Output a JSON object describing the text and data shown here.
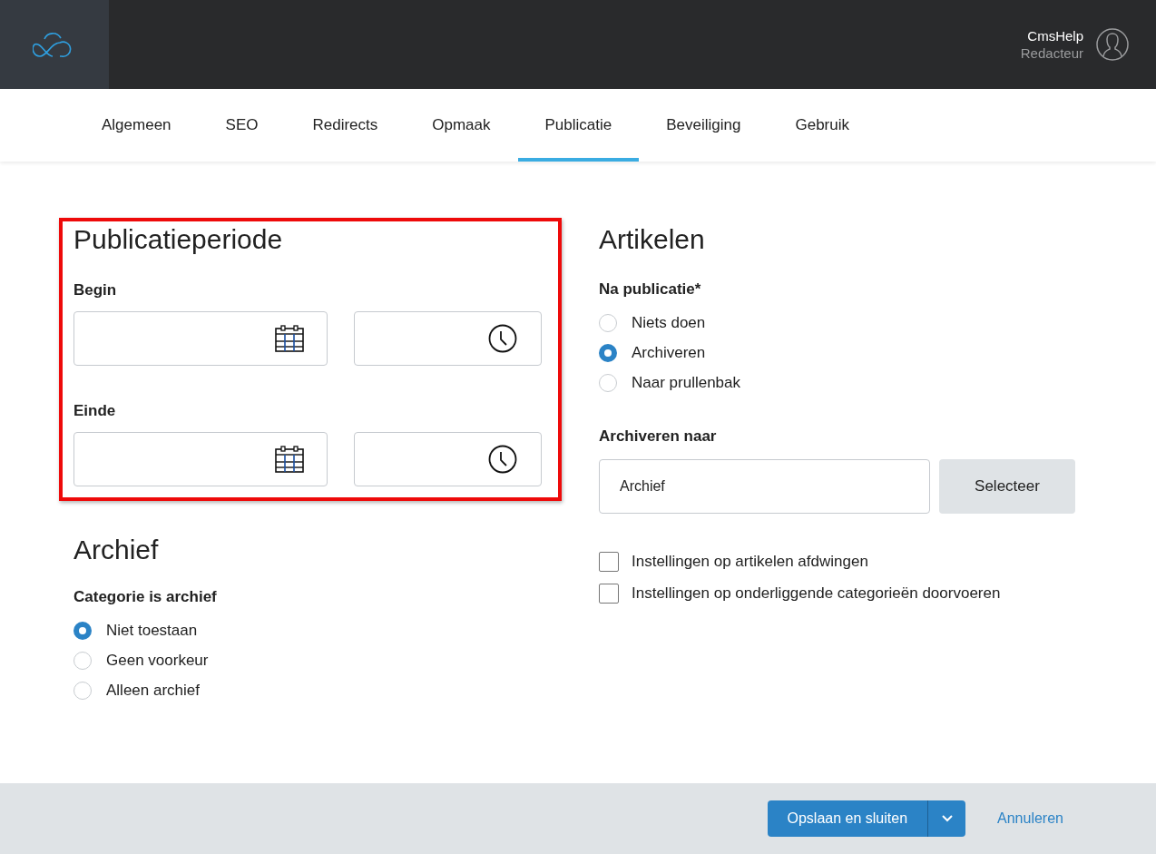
{
  "header": {
    "user_name": "CmsHelp",
    "user_role": "Redacteur"
  },
  "tabs": [
    {
      "label": "Algemeen",
      "selected": false
    },
    {
      "label": "SEO",
      "selected": false
    },
    {
      "label": "Redirects",
      "selected": false
    },
    {
      "label": "Opmaak",
      "selected": false
    },
    {
      "label": "Publicatie",
      "selected": true
    },
    {
      "label": "Beveiliging",
      "selected": false
    },
    {
      "label": "Gebruik",
      "selected": false
    }
  ],
  "publication_period": {
    "title": "Publicatieperiode",
    "highlighted": true,
    "rows": [
      {
        "label": "Begin"
      },
      {
        "label": "Einde"
      }
    ]
  },
  "archive": {
    "title": "Archief",
    "group_label": "Categorie is archief",
    "options": [
      {
        "label": "Niet toestaan",
        "selected": true
      },
      {
        "label": "Geen voorkeur",
        "selected": false
      },
      {
        "label": "Alleen archief",
        "selected": false
      }
    ]
  },
  "articles": {
    "title": "Artikelen",
    "group_label": "Na publicatie*",
    "options": [
      {
        "label": "Niets doen",
        "selected": false
      },
      {
        "label": "Archiveren",
        "selected": true
      },
      {
        "label": "Naar prullenbak",
        "selected": false
      }
    ],
    "archive_to": {
      "label": "Archiveren naar",
      "value": "Archief",
      "button": "Selecteer"
    },
    "checkboxes": [
      {
        "label": "Instellingen op artikelen afdwingen",
        "checked": false
      },
      {
        "label": "Instellingen op onderliggende categorieën doorvoeren",
        "checked": false
      }
    ]
  },
  "footer": {
    "save_button": "Opslaan en sluiten",
    "cancel_link": "Annuleren"
  }
}
